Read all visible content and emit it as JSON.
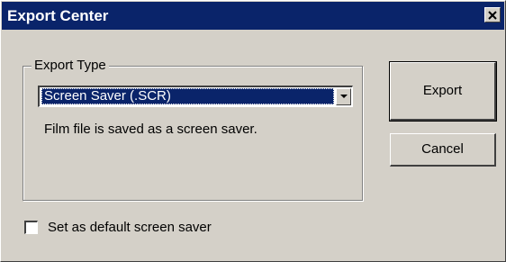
{
  "window": {
    "title": "Export Center"
  },
  "export_type": {
    "group_label": "Export Type",
    "selected": "Screen Saver (.SCR)",
    "description": "Film file is saved as a screen saver."
  },
  "buttons": {
    "export_label": "Export",
    "cancel_label": "Cancel"
  },
  "options": {
    "default_screensaver_label": "Set as default screen saver",
    "default_screensaver_checked": false
  },
  "icons": {
    "close": "close-icon",
    "dropdown": "chevron-down-icon"
  },
  "colors": {
    "titlebar": "#0a246a",
    "dialog_face": "#d4d0c8",
    "selection": "#0a246a"
  }
}
